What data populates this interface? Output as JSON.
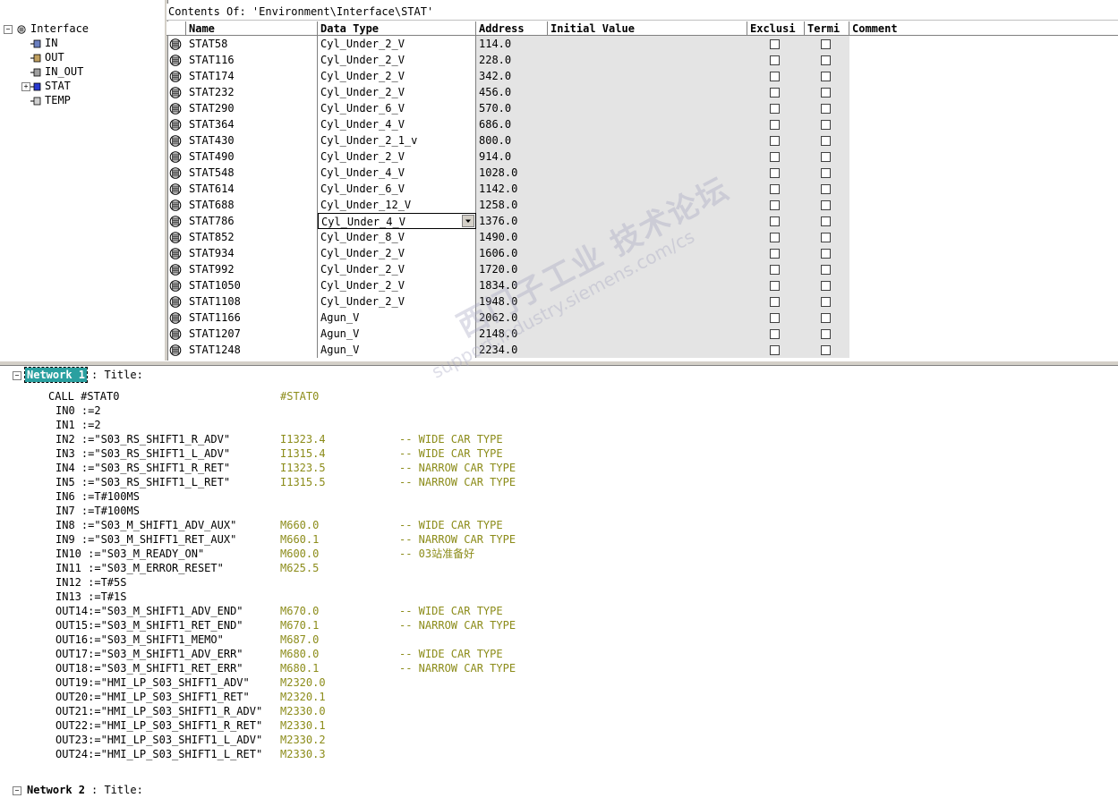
{
  "contents_label": "Contents Of: 'Environment\\Interface\\STAT'",
  "tree": {
    "root": "Interface",
    "items": [
      "IN",
      "OUT",
      "IN_OUT",
      "STAT",
      "TEMP"
    ]
  },
  "columns": [
    "Name",
    "Data Type",
    "Address",
    "Initial Value",
    "Exclusi",
    "Termi",
    "Comment"
  ],
  "rows": [
    {
      "name": "STAT58",
      "type": "Cyl_Under_2_V",
      "addr": "114.0"
    },
    {
      "name": "STAT116",
      "type": "Cyl_Under_2_V",
      "addr": "228.0"
    },
    {
      "name": "STAT174",
      "type": "Cyl_Under_2_V",
      "addr": "342.0"
    },
    {
      "name": "STAT232",
      "type": "Cyl_Under_2_V",
      "addr": "456.0"
    },
    {
      "name": "STAT290",
      "type": "Cyl_Under_6_V",
      "addr": "570.0"
    },
    {
      "name": "STAT364",
      "type": "Cyl_Under_4_V",
      "addr": "686.0"
    },
    {
      "name": "STAT430",
      "type": "Cyl_Under_2_1_v",
      "addr": "800.0"
    },
    {
      "name": "STAT490",
      "type": "Cyl_Under_2_V",
      "addr": "914.0"
    },
    {
      "name": "STAT548",
      "type": "Cyl_Under_4_V",
      "addr": "1028.0"
    },
    {
      "name": "STAT614",
      "type": "Cyl_Under_6_V",
      "addr": "1142.0"
    },
    {
      "name": "STAT688",
      "type": "Cyl_Under_12_V",
      "addr": "1258.0"
    },
    {
      "name": "STAT786",
      "type": "Cyl_Under_4_V",
      "addr": "1376.0"
    },
    {
      "name": "STAT852",
      "type": "Cyl_Under_8_V",
      "addr": "1490.0"
    },
    {
      "name": "STAT934",
      "type": "Cyl_Under_2_V",
      "addr": "1606.0"
    },
    {
      "name": "STAT992",
      "type": "Cyl_Under_2_V",
      "addr": "1720.0"
    },
    {
      "name": "STAT1050",
      "type": "Cyl_Under_2_V",
      "addr": "1834.0"
    },
    {
      "name": "STAT1108",
      "type": "Cyl_Under_2_V",
      "addr": "1948.0"
    },
    {
      "name": "STAT1166",
      "type": "Agun_V",
      "addr": "2062.0"
    },
    {
      "name": "STAT1207",
      "type": "Agun_V",
      "addr": "2148.0"
    },
    {
      "name": "STAT1248",
      "type": "Agun_V",
      "addr": "2234.0"
    }
  ],
  "network1": {
    "label": "Network 1",
    "title": ": Title:",
    "call": "CALL  #STAT0",
    "call_instance": "#STAT0",
    "lines": [
      {
        "param": "IN0  :=2",
        "addr": "",
        "comment": ""
      },
      {
        "param": "IN1  :=2",
        "addr": "",
        "comment": ""
      },
      {
        "param": "IN2  :=\"S03_RS_SHIFT1_R_ADV\"",
        "addr": "I1323.4",
        "comment": "-- WIDE CAR TYPE"
      },
      {
        "param": "IN3  :=\"S03_RS_SHIFT1_L_ADV\"",
        "addr": "I1315.4",
        "comment": "-- WIDE CAR TYPE"
      },
      {
        "param": "IN4  :=\"S03_RS_SHIFT1_R_RET\"",
        "addr": "I1323.5",
        "comment": "-- NARROW CAR TYPE"
      },
      {
        "param": "IN5  :=\"S03_RS_SHIFT1_L_RET\"",
        "addr": "I1315.5",
        "comment": "-- NARROW CAR TYPE"
      },
      {
        "param": "IN6  :=T#100MS",
        "addr": "",
        "comment": ""
      },
      {
        "param": "IN7  :=T#100MS",
        "addr": "",
        "comment": ""
      },
      {
        "param": "IN8  :=\"S03_M_SHIFT1_ADV_AUX\"",
        "addr": "M660.0",
        "comment": "-- WIDE CAR TYPE"
      },
      {
        "param": "IN9  :=\"S03_M_SHIFT1_RET_AUX\"",
        "addr": "M660.1",
        "comment": "-- NARROW CAR TYPE"
      },
      {
        "param": "IN10 :=\"S03_M_READY_ON\"",
        "addr": "M600.0",
        "comment": "-- 03站准备好"
      },
      {
        "param": "IN11 :=\"S03_M_ERROR_RESET\"",
        "addr": "M625.5",
        "comment": ""
      },
      {
        "param": "IN12 :=T#5S",
        "addr": "",
        "comment": ""
      },
      {
        "param": "IN13 :=T#1S",
        "addr": "",
        "comment": ""
      },
      {
        "param": "OUT14:=\"S03_M_SHIFT1_ADV_END\"",
        "addr": "M670.0",
        "comment": "-- WIDE CAR TYPE"
      },
      {
        "param": "OUT15:=\"S03_M_SHIFT1_RET_END\"",
        "addr": "M670.1",
        "comment": "-- NARROW CAR TYPE"
      },
      {
        "param": "OUT16:=\"S03_M_SHIFT1_MEMO\"",
        "addr": "M687.0",
        "comment": ""
      },
      {
        "param": "OUT17:=\"S03_M_SHIFT1_ADV_ERR\"",
        "addr": "M680.0",
        "comment": "-- WIDE CAR TYPE"
      },
      {
        "param": "OUT18:=\"S03_M_SHIFT1_RET_ERR\"",
        "addr": "M680.1",
        "comment": "-- NARROW CAR TYPE"
      },
      {
        "param": "OUT19:=\"HMI_LP_S03_SHIFT1_ADV\"",
        "addr": "M2320.0",
        "comment": ""
      },
      {
        "param": "OUT20:=\"HMI_LP_S03_SHIFT1_RET\"",
        "addr": "M2320.1",
        "comment": ""
      },
      {
        "param": "OUT21:=\"HMI_LP_S03_SHIFT1_R_ADV\"",
        "addr": "M2330.0",
        "comment": ""
      },
      {
        "param": "OUT22:=\"HMI_LP_S03_SHIFT1_R_RET\"",
        "addr": "M2330.1",
        "comment": ""
      },
      {
        "param": "OUT23:=\"HMI_LP_S03_SHIFT1_L_ADV\"",
        "addr": "M2330.2",
        "comment": ""
      },
      {
        "param": "OUT24:=\"HMI_LP_S03_SHIFT1_L_RET\"",
        "addr": "M2330.3",
        "comment": ""
      }
    ]
  },
  "network2": {
    "label": "Network 2",
    "title": ": Title:"
  },
  "watermark": {
    "big": "西门子工业 技术论坛",
    "small": "support.industry.siemens.com/cs"
  }
}
